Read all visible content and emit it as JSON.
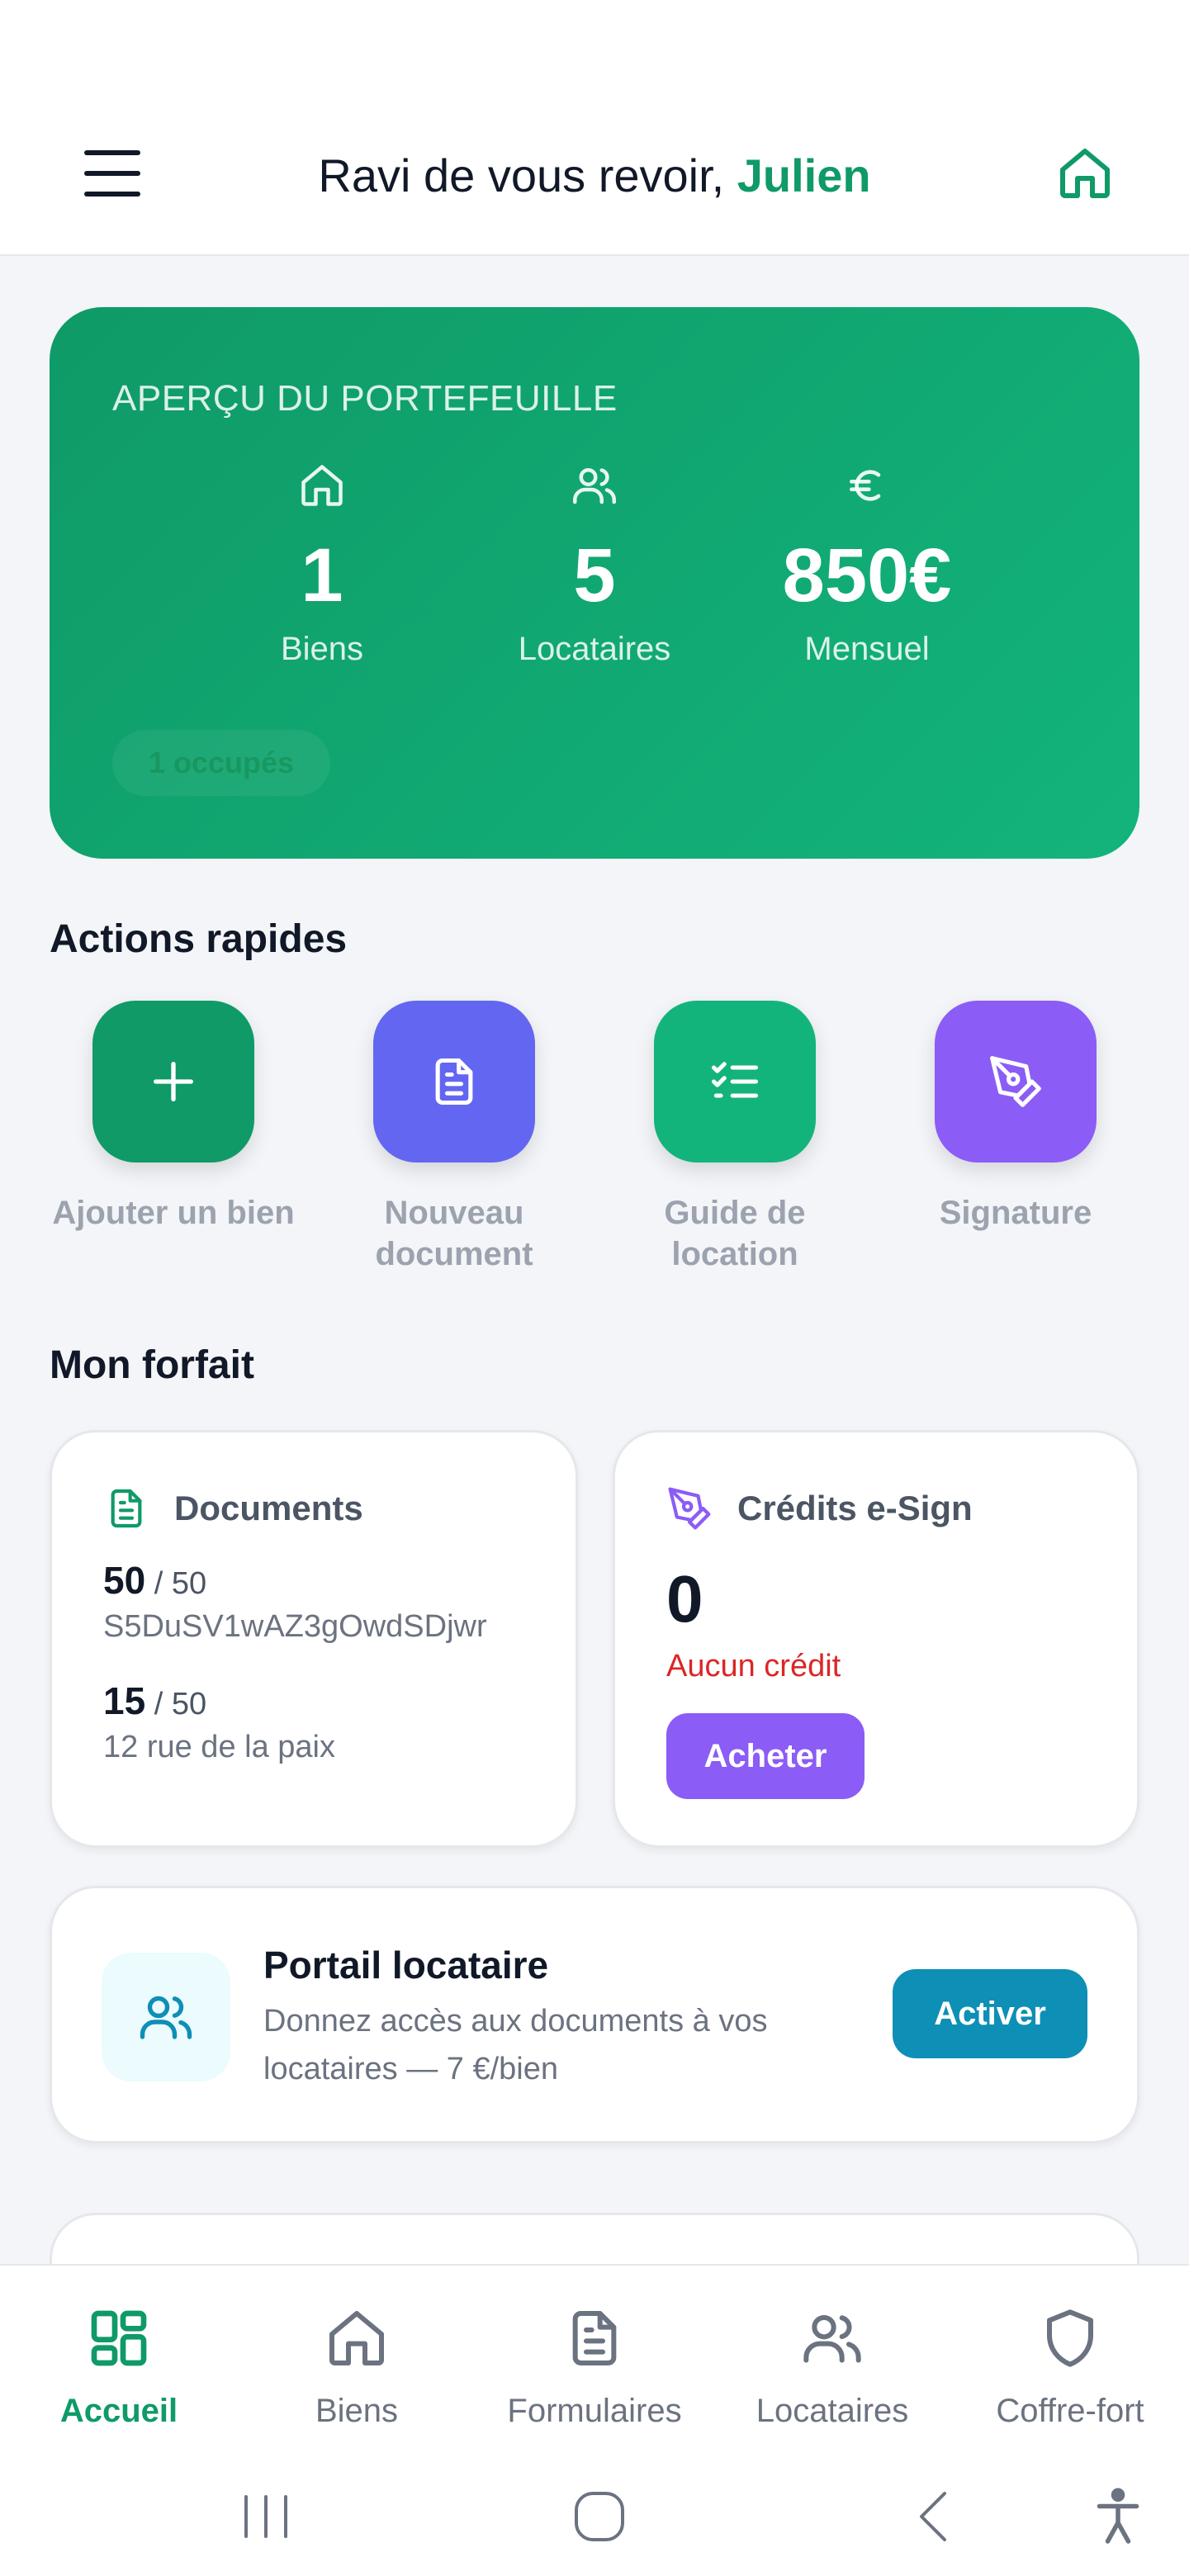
{
  "header": {
    "greeting": "Ravi de vous revoir, ",
    "user_name": "Julien"
  },
  "portfolio": {
    "title": "APERÇU DU PORTEFEUILLE",
    "stats": [
      {
        "icon": "home-icon",
        "value": "1",
        "label": "Biens"
      },
      {
        "icon": "users-icon",
        "value": "5",
        "label": "Locataires"
      },
      {
        "icon": "euro-icon",
        "value": "850€",
        "label": "Mensuel"
      }
    ],
    "occupied_badge": "1 occupés"
  },
  "quick_actions": {
    "title": "Actions rapides",
    "items": [
      {
        "icon": "plus-icon",
        "label": "Ajouter un bien",
        "color": "#0f9a67"
      },
      {
        "icon": "document-icon",
        "label": "Nouveau document",
        "color": "#6366f1"
      },
      {
        "icon": "checklist-icon",
        "label": "Guide de location",
        "color": "#13b47c"
      },
      {
        "icon": "pen-icon",
        "label": "Signature",
        "color": "#8b5cf6"
      }
    ]
  },
  "plan": {
    "title": "Mon forfait",
    "documents": {
      "title": "Documents",
      "rows": [
        {
          "used": "50",
          "total": "/ 50",
          "label": "S5DuSV1wAZ3gOwdSDjwr"
        },
        {
          "used": "15",
          "total": "/ 50",
          "label": "12 rue de la paix"
        }
      ]
    },
    "esign": {
      "title": "Crédits e-Sign",
      "count": "0",
      "status": "Aucun crédit",
      "buy_label": "Acheter"
    }
  },
  "portal": {
    "title": "Portail locataire",
    "description": "Donnez accès aux documents à vos locataires — 7 €/bien",
    "activate_label": "Activer"
  },
  "bottom_nav": {
    "items": [
      {
        "icon": "dashboard-icon",
        "label": "Accueil",
        "active": true
      },
      {
        "icon": "home-icon",
        "label": "Biens",
        "active": false
      },
      {
        "icon": "document-icon",
        "label": "Formulaires",
        "active": false
      },
      {
        "icon": "users-icon",
        "label": "Locataires",
        "active": false
      },
      {
        "icon": "shield-icon",
        "label": "Coffre-fort",
        "active": false
      }
    ]
  },
  "colors": {
    "brand": "#0f9a67",
    "indigo": "#6366f1",
    "purple": "#8b5cf6",
    "teal": "#0e8fb6",
    "danger": "#dc2626"
  }
}
